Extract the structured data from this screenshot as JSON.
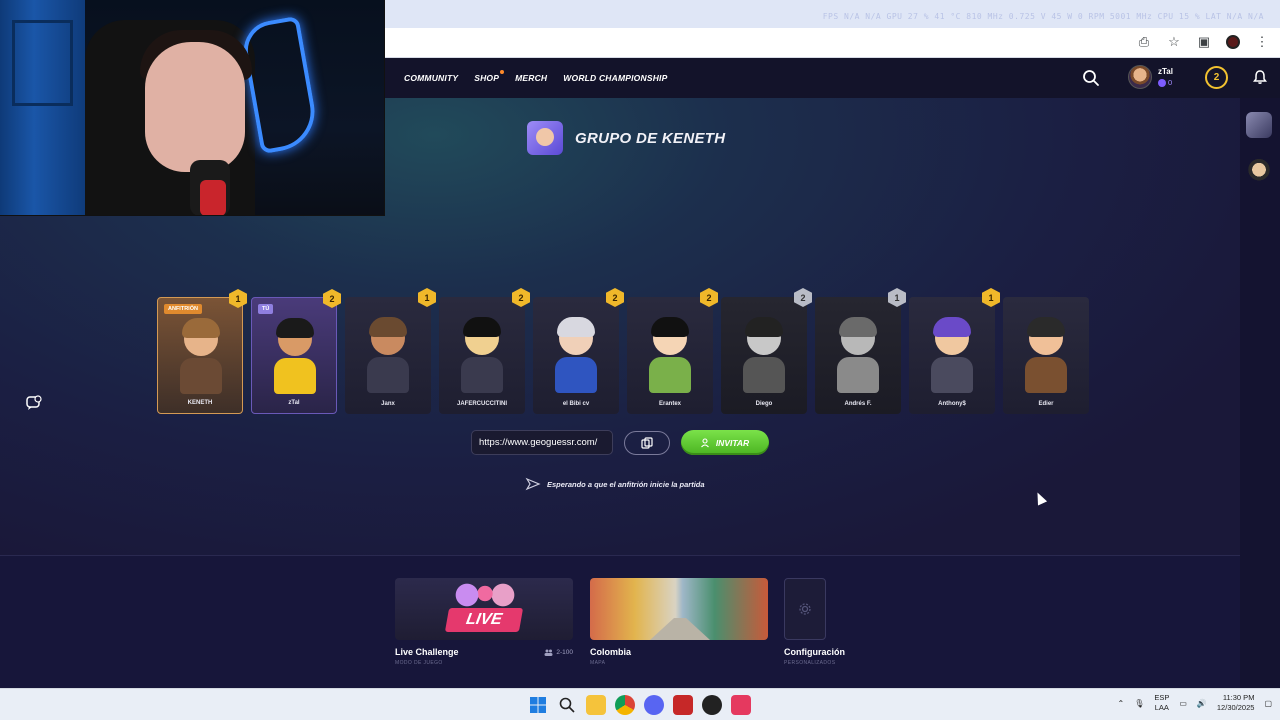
{
  "browser": {
    "overlay_stats": "FPS N/A N/A   GPU 27 % 41 °C 810 MHz 0.725 V 45 W 0 RPM 5001 MHz   CPU 15 %   LAT N/A N/A"
  },
  "nav": {
    "links": [
      "COMMUNITY",
      "SHOP",
      "MERCH",
      "WORLD CHAMPIONSHIP"
    ],
    "user_name": "zTal",
    "user_coins": "0",
    "level": "2"
  },
  "group": {
    "title": "GRUPO DE KENETH"
  },
  "players": [
    {
      "name": "KENETH",
      "level": "1",
      "tag": "ANFITRIÓN",
      "style": "host",
      "skin": "#e7b48a",
      "hair": "#9a6a3a",
      "shirt": "#6b4a34"
    },
    {
      "name": "zTal",
      "level": "2",
      "tag": "TÚ",
      "style": "self",
      "skin": "#d99a66",
      "hair": "#1a1a1a",
      "shirt": "#f0c21f"
    },
    {
      "name": "Janx",
      "level": "1",
      "tag": "",
      "style": "normal",
      "skin": "#c98a60",
      "hair": "#6a4a30",
      "shirt": "#3a3a4e"
    },
    {
      "name": "JAFERCUCCITINI",
      "level": "2",
      "tag": "",
      "style": "normal",
      "skin": "#f0d090",
      "hair": "#111111",
      "shirt": "#3a3a4e"
    },
    {
      "name": "el Bibi cv",
      "level": "2",
      "tag": "",
      "style": "normal",
      "skin": "#f0d0b8",
      "hair": "#d8d8e0",
      "shirt": "#2f55c0"
    },
    {
      "name": "Erantex",
      "level": "2",
      "tag": "",
      "style": "normal",
      "skin": "#f5d5b5",
      "hair": "#111111",
      "shirt": "#7ab04a"
    },
    {
      "name": "Diego",
      "level": "2",
      "tag": "",
      "style": "muted",
      "skin": "#c8c8c8",
      "hair": "#222222",
      "shirt": "#555555"
    },
    {
      "name": "Andrés F.",
      "level": "1",
      "tag": "",
      "style": "muted",
      "skin": "#b8b8b8",
      "hair": "#6a6a6a",
      "shirt": "#8a8a8a"
    },
    {
      "name": "Anthony$",
      "level": "1",
      "tag": "",
      "style": "normal",
      "skin": "#f0c8a0",
      "hair": "#6a4ac8",
      "shirt": "#4a4a5e"
    },
    {
      "name": "Edier",
      "level": "",
      "tag": "",
      "style": "normal",
      "skin": "#f0c098",
      "hair": "#2a2a2a",
      "shirt": "#7a5030"
    }
  ],
  "invite": {
    "link": "https://www.geoguessr.com/",
    "button": "INVITAR",
    "waiting": "Esperando a que el anfitrión inicie la partida"
  },
  "bottom": {
    "mode_title": "Live Challenge",
    "mode_sub": "MODO DE JUEGO",
    "mode_players": "2-100",
    "live_label": "LIVE",
    "map_title": "Colombia",
    "map_sub": "MAPA",
    "config_title": "Configuración",
    "config_sub": "PERSONALIZADOS"
  },
  "taskbar": {
    "lang1": "ESP",
    "lang2": "LAA",
    "time": "11:30 PM",
    "date": "12/30/2025"
  },
  "colors": {
    "accent_green": "#4ab321",
    "level_gold": "#f0b82a",
    "level_silver": "#b9bcc6"
  }
}
